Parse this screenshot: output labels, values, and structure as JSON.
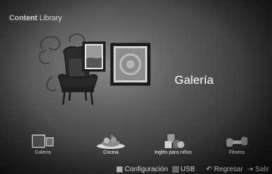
{
  "header": {
    "title_bold": "Content",
    "title_rest": "Library"
  },
  "hero": {
    "label": "Galería"
  },
  "categories": [
    {
      "label": "Galería",
      "icon": "gallery-icon"
    },
    {
      "label": "Cocina",
      "icon": "cooking-icon"
    },
    {
      "label": "Inglés para niños",
      "icon": "kids-english-icon"
    },
    {
      "label": "Fitness",
      "icon": "dumbbell-icon"
    }
  ],
  "footer": {
    "config_label": "Configuración",
    "usb_label": "USB",
    "back_label": "Regresar",
    "exit_label": "Salir"
  }
}
